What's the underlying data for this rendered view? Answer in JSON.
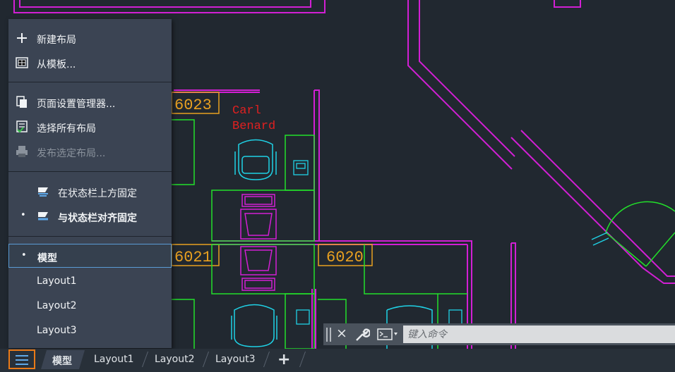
{
  "drawing": {
    "room_labels": [
      "6023",
      "6021",
      "6020"
    ],
    "person_name": [
      "Carl",
      "Benard"
    ]
  },
  "layout_menu": {
    "new_layout": "新建布局",
    "from_template": "从模板...",
    "page_setup_manager": "页面设置管理器...",
    "select_all_layouts": "选择所有布局",
    "publish_selected_layouts": "发布选定布局...",
    "dock_above_status_bar": "在状态栏上方固定",
    "dock_inline_status_bar": "与状态栏对齐固定",
    "items": [
      "模型",
      "Layout1",
      "Layout2",
      "Layout3"
    ],
    "selected_item": "模型",
    "checked_bullet": "•"
  },
  "tabs": {
    "model": "模型",
    "layouts": [
      "Layout1",
      "Layout2",
      "Layout3"
    ],
    "add": "+"
  },
  "command_line": {
    "placeholder": "键入命令",
    "close": "×"
  },
  "colors": {
    "background": "#212830",
    "walls": "#d21fd4",
    "furniture": "#22e02a",
    "chair": "#1fd2e6",
    "label_box": "#e8a020",
    "name_text": "#e02020",
    "menu_bg": "#3b4453",
    "accent": "#e87a18",
    "selection": "#5a9bd5"
  },
  "icons": [
    "plus-icon",
    "template-icon",
    "page-setup-icon",
    "select-layouts-icon",
    "publish-icon",
    "dock-above-icon",
    "dock-inline-icon",
    "hamburger-icon",
    "close-icon",
    "wrench-icon",
    "command-prompt-icon"
  ]
}
